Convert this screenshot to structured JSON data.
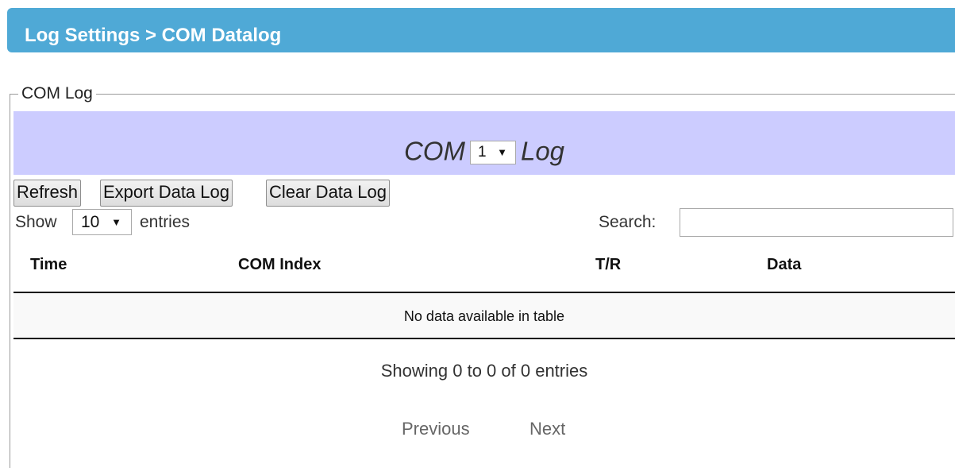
{
  "header": {
    "title": "Log Settings > COM Datalog"
  },
  "fieldset": {
    "legend": "COM Log"
  },
  "com_banner": {
    "prefix": "COM",
    "selected_port": "1",
    "suffix": "Log"
  },
  "buttons": {
    "refresh": "Refresh",
    "export": "Export Data Log",
    "clear": "Clear Data Log"
  },
  "length_menu": {
    "show": "Show",
    "selected": "10",
    "entries": "entries"
  },
  "search": {
    "label": "Search:",
    "value": ""
  },
  "table": {
    "columns": [
      "Time",
      "COM Index",
      "T/R",
      "Data"
    ],
    "empty_message": "No data available in table"
  },
  "info": "Showing 0 to 0 of 0 entries",
  "pagination": {
    "previous": "Previous",
    "next": "Next"
  },
  "icons": {
    "dropdown": "chevron-down-icon"
  },
  "colors": {
    "header_bg": "#4fa9d6",
    "banner_bg": "#ccccff"
  }
}
